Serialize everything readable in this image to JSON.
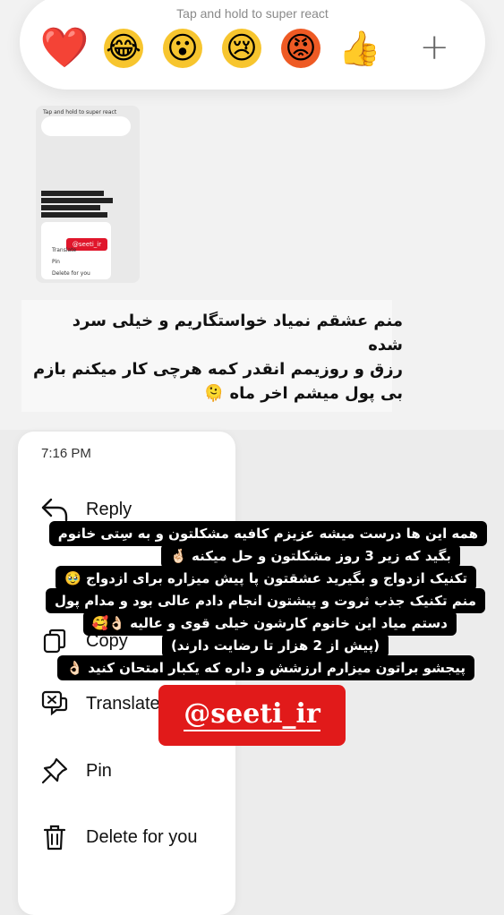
{
  "reactions": {
    "hint": "Tap and hold to super react",
    "emojis": [
      "❤️",
      "😂",
      "😮",
      "😢",
      "😡",
      "👍"
    ],
    "add_symbol": "+"
  },
  "thumbnail": {
    "hint": "Tap and hold to super react",
    "tag": "@seeti_ir",
    "items": [
      "Translate",
      "Pin",
      "Delete for you"
    ]
  },
  "message": {
    "lines": [
      "منم عشقم نمیاد خواستگاریم و خیلی سرد",
      "شده",
      "رزق و روزیمم انقدر کمه هرچی کار میکنم بازم",
      "بی پول میشم اخر ماه 🫠"
    ]
  },
  "menu": {
    "time": "7:16 PM",
    "items": [
      {
        "label": "Reply",
        "icon": "reply-icon"
      },
      {
        "label": "Copy",
        "icon": "copy-icon"
      },
      {
        "label": "Translate",
        "icon": "translate-icon"
      },
      {
        "label": "Pin",
        "icon": "pin-icon"
      },
      {
        "label": "Delete for you",
        "icon": "trash-icon"
      }
    ]
  },
  "caption": {
    "lines": [
      "همه این ها درست میشه عزیزم کافیه مشکلتون و به سِتی خانوم",
      "بگید که زیر 3 روز مشکلتون و حل میکنه 🤞🏻",
      "تکنیک ازدواج و بگیرید عشقتون پا پیش میزاره برای ازدواج 🥹",
      "منم تکنیک جذب ثروت و پیشتون انجام دادم عالی بود و مدام پول",
      "دستم میاد این خانوم کارشون خیلی قوی و عالیه 👌🏻🥰",
      "(پیش از 2 هزار تا رضایت دارند)",
      "پیجشو براتون میزارم ارزشش و داره که یکبار امتحان کنید 👌🏻"
    ]
  },
  "watermark": "@seeti_ir"
}
